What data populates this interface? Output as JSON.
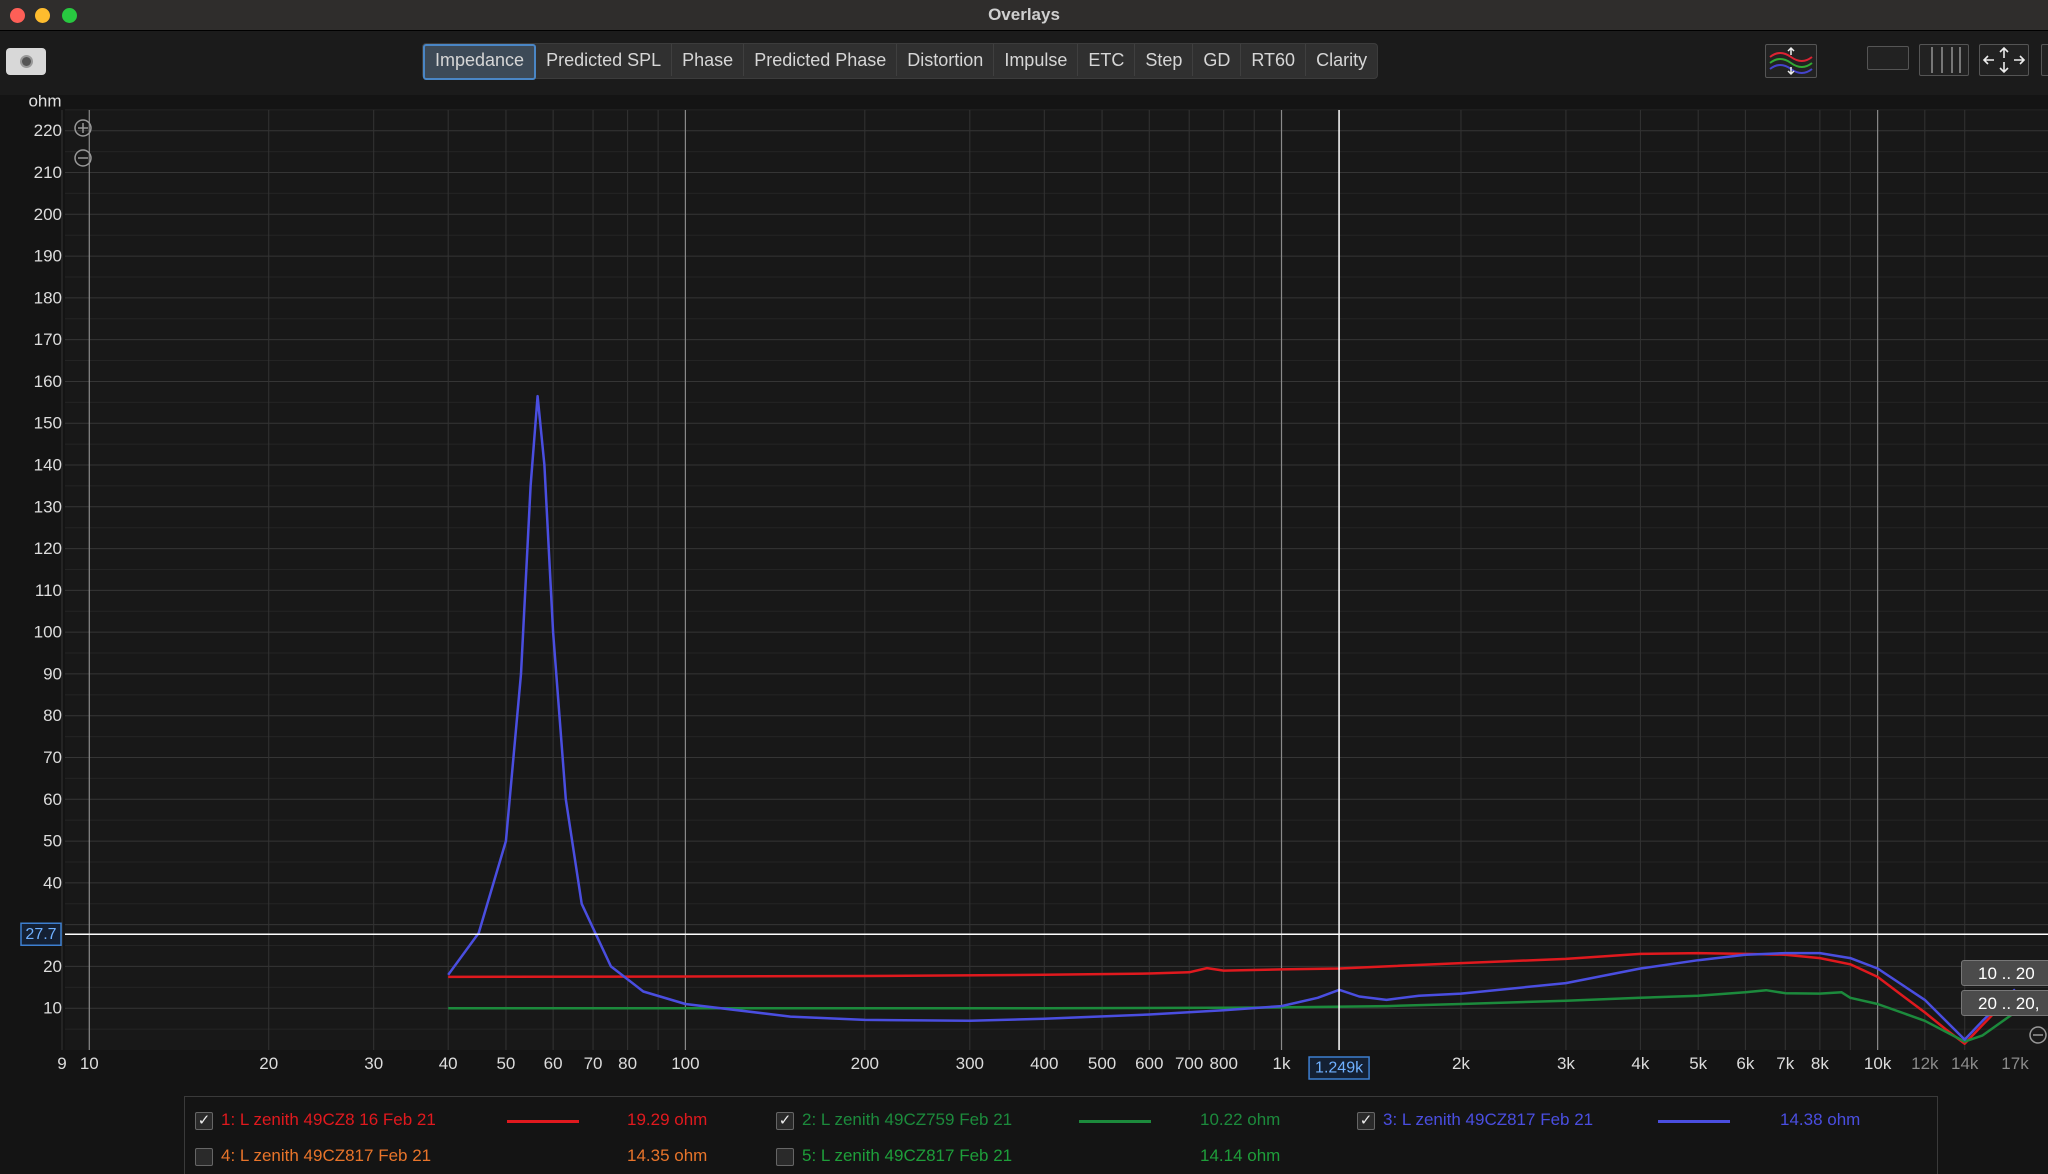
{
  "window": {
    "title": "Overlays"
  },
  "toolbar": {
    "tabs": [
      {
        "label": "Impedance",
        "active": true
      },
      {
        "label": "Predicted SPL",
        "active": false
      },
      {
        "label": "Phase",
        "active": false
      },
      {
        "label": "Predicted Phase",
        "active": false
      },
      {
        "label": "Distortion",
        "active": false
      },
      {
        "label": "Impulse",
        "active": false
      },
      {
        "label": "ETC",
        "active": false
      },
      {
        "label": "Step",
        "active": false
      },
      {
        "label": "GD",
        "active": false
      },
      {
        "label": "RT60",
        "active": false
      },
      {
        "label": "Clarity",
        "active": false
      }
    ]
  },
  "cursor": {
    "y_readout": "27.7",
    "x_readout": "1.249k",
    "y_value": 27.7,
    "x_value": 1249
  },
  "range_buttons": [
    {
      "label": "10 .. 20"
    },
    {
      "label": "20 .. 20,"
    }
  ],
  "chart_data": {
    "type": "line",
    "ylabel": "ohm",
    "x_scale": "log",
    "xlim": [
      9,
      17000
    ],
    "ylim": [
      0,
      225
    ],
    "grid": true,
    "x_ticks": [
      {
        "v": 9,
        "label": "9"
      },
      {
        "v": 10,
        "label": "10"
      },
      {
        "v": 20,
        "label": "20"
      },
      {
        "v": 30,
        "label": "30"
      },
      {
        "v": 40,
        "label": "40"
      },
      {
        "v": 50,
        "label": "50"
      },
      {
        "v": 60,
        "label": "60"
      },
      {
        "v": 70,
        "label": "70"
      },
      {
        "v": 80,
        "label": "80"
      },
      {
        "v": 100,
        "label": "100"
      },
      {
        "v": 200,
        "label": "200"
      },
      {
        "v": 300,
        "label": "300"
      },
      {
        "v": 400,
        "label": "400"
      },
      {
        "v": 500,
        "label": "500"
      },
      {
        "v": 600,
        "label": "600"
      },
      {
        "v": 700,
        "label": "700"
      },
      {
        "v": 800,
        "label": "800"
      },
      {
        "v": 1000,
        "label": "1k"
      },
      {
        "v": 2000,
        "label": "2k"
      },
      {
        "v": 3000,
        "label": "3k"
      },
      {
        "v": 4000,
        "label": "4k"
      },
      {
        "v": 5000,
        "label": "5k"
      },
      {
        "v": 6000,
        "label": "6k"
      },
      {
        "v": 7000,
        "label": "7k"
      },
      {
        "v": 8000,
        "label": "8k"
      },
      {
        "v": 10000,
        "label": "10k"
      },
      {
        "v": 12000,
        "label": "12k"
      },
      {
        "v": 14000,
        "label": "14k"
      },
      {
        "v": 17000,
        "label": "17k"
      }
    ],
    "y_ticks": [
      {
        "v": 10,
        "label": "10"
      },
      {
        "v": 20,
        "label": "20"
      },
      {
        "v": 40,
        "label": "40"
      },
      {
        "v": 50,
        "label": "50"
      },
      {
        "v": 60,
        "label": "60"
      },
      {
        "v": 70,
        "label": "70"
      },
      {
        "v": 80,
        "label": "80"
      },
      {
        "v": 90,
        "label": "90"
      },
      {
        "v": 100,
        "label": "100"
      },
      {
        "v": 110,
        "label": "110"
      },
      {
        "v": 120,
        "label": "120"
      },
      {
        "v": 130,
        "label": "130"
      },
      {
        "v": 140,
        "label": "140"
      },
      {
        "v": 150,
        "label": "150"
      },
      {
        "v": 160,
        "label": "160"
      },
      {
        "v": 170,
        "label": "170"
      },
      {
        "v": 180,
        "label": "180"
      },
      {
        "v": 190,
        "label": "190"
      },
      {
        "v": 200,
        "label": "200"
      },
      {
        "v": 210,
        "label": "210"
      },
      {
        "v": 220,
        "label": "220"
      }
    ],
    "series": [
      {
        "name": "1: L zenith 49CZ8 16 Feb 21",
        "color": "#e0191e",
        "checked": true,
        "readout": "19.29 ohm",
        "points": [
          [
            40,
            17.5
          ],
          [
            100,
            17.6
          ],
          [
            200,
            17.7
          ],
          [
            400,
            18.0
          ],
          [
            600,
            18.3
          ],
          [
            700,
            18.6
          ],
          [
            750,
            19.6
          ],
          [
            800,
            19.0
          ],
          [
            1000,
            19.3
          ],
          [
            1250,
            19.5
          ],
          [
            1500,
            20.0
          ],
          [
            2000,
            20.8
          ],
          [
            3000,
            21.8
          ],
          [
            4000,
            23.0
          ],
          [
            5000,
            23.2
          ],
          [
            6000,
            23.0
          ],
          [
            7000,
            22.8
          ],
          [
            8000,
            22.0
          ],
          [
            9000,
            20.5
          ],
          [
            10000,
            17.5
          ],
          [
            12000,
            9.0
          ],
          [
            13000,
            5.0
          ],
          [
            14000,
            1.5
          ],
          [
            15000,
            6.0
          ],
          [
            17000,
            14.0
          ]
        ]
      },
      {
        "name": "2: L zenith 49CZ759 Feb 21",
        "color": "#1c8a3c",
        "checked": true,
        "readout": "10.22 ohm",
        "points": [
          [
            40,
            10.0
          ],
          [
            100,
            10.0
          ],
          [
            200,
            10.0
          ],
          [
            400,
            10.0
          ],
          [
            800,
            10.1
          ],
          [
            1000,
            10.2
          ],
          [
            1500,
            10.5
          ],
          [
            2000,
            11.0
          ],
          [
            3000,
            11.8
          ],
          [
            4000,
            12.5
          ],
          [
            5000,
            13.0
          ],
          [
            6000,
            13.8
          ],
          [
            6500,
            14.3
          ],
          [
            7000,
            13.6
          ],
          [
            8000,
            13.5
          ],
          [
            8700,
            13.8
          ],
          [
            9000,
            12.5
          ],
          [
            10000,
            11.0
          ],
          [
            12000,
            7.0
          ],
          [
            14000,
            2.0
          ],
          [
            15000,
            3.5
          ],
          [
            17000,
            9.0
          ]
        ]
      },
      {
        "name": "3: L zenith 49CZ817 Feb 21",
        "color": "#4a4ee0",
        "checked": true,
        "readout": "14.38 ohm",
        "points": [
          [
            40,
            18.0
          ],
          [
            45,
            28.0
          ],
          [
            50,
            50.0
          ],
          [
            53,
            90.0
          ],
          [
            55,
            135.0
          ],
          [
            56.5,
            156.5
          ],
          [
            58,
            140.0
          ],
          [
            60,
            100.0
          ],
          [
            63,
            60.0
          ],
          [
            67,
            35.0
          ],
          [
            75,
            20.0
          ],
          [
            85,
            14.0
          ],
          [
            100,
            11.0
          ],
          [
            150,
            8.0
          ],
          [
            200,
            7.2
          ],
          [
            300,
            7.0
          ],
          [
            400,
            7.5
          ],
          [
            600,
            8.5
          ],
          [
            800,
            9.5
          ],
          [
            1000,
            10.5
          ],
          [
            1150,
            12.5
          ],
          [
            1250,
            14.4
          ],
          [
            1350,
            12.8
          ],
          [
            1500,
            12.0
          ],
          [
            1700,
            13.0
          ],
          [
            2000,
            13.5
          ],
          [
            3000,
            16.0
          ],
          [
            4000,
            19.5
          ],
          [
            5000,
            21.5
          ],
          [
            6000,
            22.8
          ],
          [
            7000,
            23.2
          ],
          [
            8000,
            23.2
          ],
          [
            9000,
            22.0
          ],
          [
            10000,
            19.5
          ],
          [
            12000,
            12.0
          ],
          [
            14000,
            2.5
          ],
          [
            15000,
            7.0
          ],
          [
            17000,
            14.5
          ]
        ]
      },
      {
        "name": "4: L zenith 49CZ817 Feb 21",
        "color": "#e8742a",
        "checked": false,
        "readout": "14.35 ohm",
        "points": []
      },
      {
        "name": "5: L zenith 49CZ817 Feb 21",
        "color": "#1e9e3a",
        "checked": false,
        "readout": "14.14 ohm",
        "points": []
      }
    ]
  }
}
